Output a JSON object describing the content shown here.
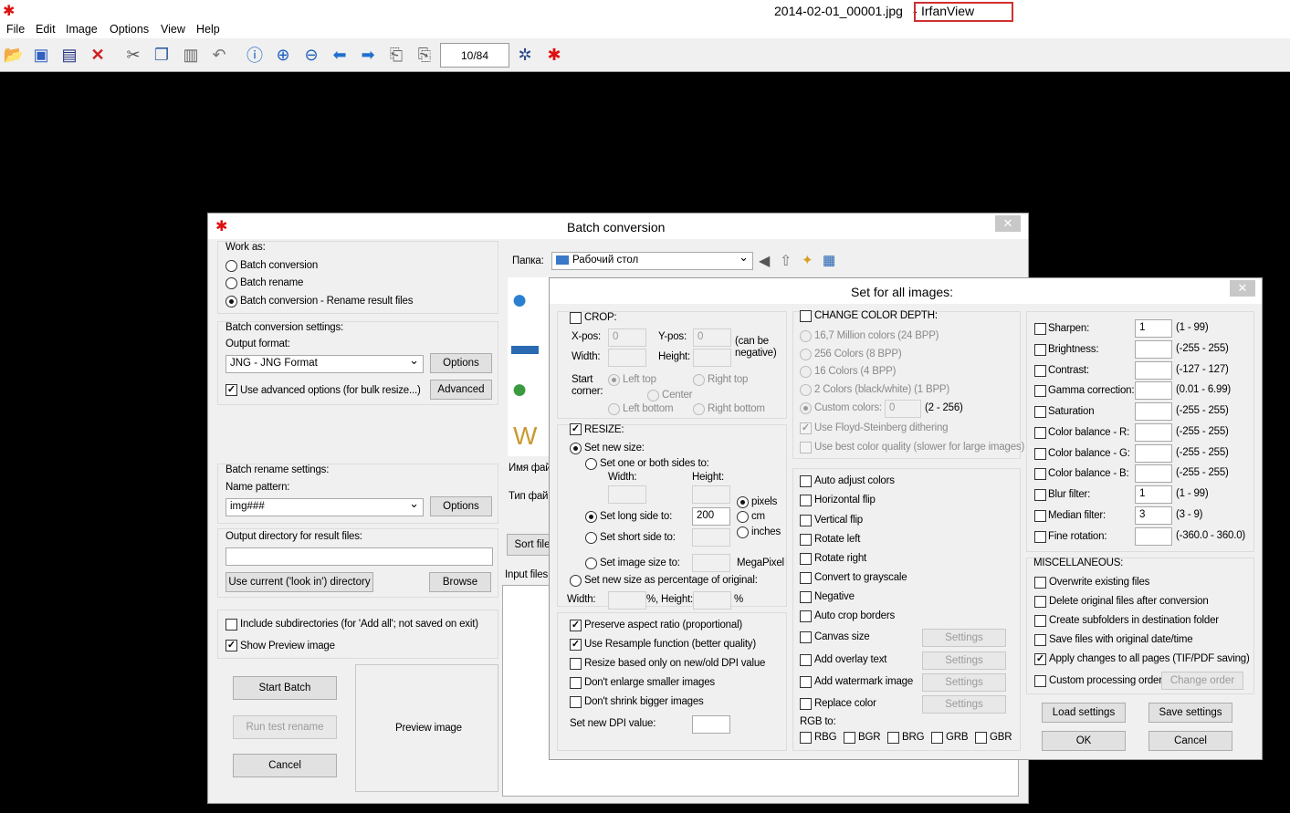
{
  "app": {
    "title_file": "2014-02-01_00001.jpg",
    "title_sep": "-",
    "title_app": "IrfanView"
  },
  "menu": [
    "File",
    "Edit",
    "Image",
    "Options",
    "View",
    "Help"
  ],
  "toolbar": {
    "page_counter": "10/84"
  },
  "batch": {
    "title": "Batch conversion",
    "work_as_label": "Work as:",
    "work_as": [
      "Batch conversion",
      "Batch rename",
      "Batch conversion - Rename result files"
    ],
    "conv_settings_label": "Batch conversion settings:",
    "output_format_label": "Output format:",
    "output_format_value": "JNG - JNG Format",
    "options_btn": "Options",
    "advanced_cb": "Use advanced options (for bulk resize...)",
    "advanced_btn": "Advanced",
    "rename_settings_label": "Batch rename settings:",
    "name_pattern_label": "Name pattern:",
    "name_pattern_value": "img###",
    "outdir_label": "Output directory for result files:",
    "use_current_btn": "Use current ('look in') directory",
    "browse_btn": "Browse",
    "include_sub": "Include subdirectories (for 'Add all'; not saved on exit)",
    "show_preview": "Show Preview image",
    "start_btn": "Start Batch",
    "run_test_btn": "Run test rename",
    "cancel_btn": "Cancel",
    "preview_label": "Preview image",
    "folder_label": "Папка:",
    "folder_value": "Рабочий стол",
    "file_name_label": "Имя фай",
    "file_type_label": "Тип фай",
    "sort_btn": "Sort file",
    "input_files_label": "Input files:"
  },
  "setall": {
    "title": "Set for all images:",
    "crop": {
      "label": "CROP:",
      "xpos": "X-pos:",
      "xval": "0",
      "ypos": "Y-pos:",
      "yval": "0",
      "can_neg": "(can be",
      "can_neg2": "negative)",
      "width": "Width:",
      "height": "Height:",
      "start": "Start",
      "corner": "corner:",
      "lt": "Left top",
      "rt": "Right top",
      "center": "Center",
      "lb": "Left bottom",
      "rb": "Right bottom"
    },
    "resize": {
      "label": "RESIZE:",
      "set_new": "Set new size:",
      "one_or_both": "Set one or both sides to:",
      "width": "Width:",
      "height": "Height:",
      "pixels": "pixels",
      "cm": "cm",
      "inches": "inches",
      "long_side": "Set long side to:",
      "long_val": "200",
      "short_side": "Set short side to:",
      "image_size": "Set image size to:",
      "megapixel": "MegaPixel",
      "percent": "Set new size as percentage of original:",
      "pw": "Width:",
      "pct": "%, Height:",
      "pct2": "%"
    },
    "opts": [
      "Preserve aspect ratio (proportional)",
      "Use Resample function (better quality)",
      "Resize based only on new/old DPI value",
      "Don't enlarge smaller images",
      "Don't shrink bigger images"
    ],
    "dpi_label": "Set new DPI value:",
    "color": {
      "label": "CHANGE COLOR DEPTH:",
      "items": [
        "16,7 Million colors (24 BPP)",
        "256 Colors (8 BPP)",
        "16 Colors (4 BPP)",
        "2 Colors (black/white) (1 BPP)",
        "Custom colors:"
      ],
      "custom_val": "0",
      "custom_range": "(2 - 256)",
      "floyd": "Use Floyd-Steinberg dithering",
      "best": "Use best color quality (slower for large images)"
    },
    "mid": [
      "Auto adjust colors",
      "Horizontal flip",
      "Vertical flip",
      "Rotate left",
      "Rotate right",
      "Convert to grayscale",
      "Negative",
      "Auto crop borders"
    ],
    "mid_settings": [
      "Canvas size",
      "Add overlay text",
      "Add watermark image",
      "Replace color"
    ],
    "settings_btn": "Settings",
    "rgb_label": "RGB to:",
    "rgb": [
      "RBG",
      "BGR",
      "BRG",
      "GRB",
      "GBR"
    ],
    "right": [
      {
        "label": "Sharpen:",
        "val": "1",
        "range": "(1  -  99)"
      },
      {
        "label": "Brightness:",
        "val": "",
        "range": "(-255  -  255)"
      },
      {
        "label": "Contrast:",
        "val": "",
        "range": "(-127  -  127)"
      },
      {
        "label": "Gamma correction:",
        "val": "",
        "range": "(0.01  -  6.99)"
      },
      {
        "label": "Saturation",
        "val": "",
        "range": "(-255  -  255)"
      },
      {
        "label": "Color balance - R:",
        "val": "",
        "range": "(-255  -  255)"
      },
      {
        "label": "Color balance - G:",
        "val": "",
        "range": "(-255  -  255)"
      },
      {
        "label": "Color balance - B:",
        "val": "",
        "range": "(-255  -  255)"
      },
      {
        "label": "Blur filter:",
        "val": "1",
        "range": "(1  -  99)"
      },
      {
        "label": "Median filter:",
        "val": "3",
        "range": "(3  -  9)"
      },
      {
        "label": "Fine rotation:",
        "val": "",
        "range": "(-360.0  -  360.0)"
      }
    ],
    "misc_label": "MISCELLANEOUS:",
    "misc": [
      "Overwrite existing files",
      "Delete original files after conversion",
      "Create subfolders in destination folder",
      "Save files with original date/time",
      "Apply changes to all pages (TIF/PDF saving)",
      "Custom processing order"
    ],
    "change_order": "Change order",
    "load": "Load settings",
    "save": "Save settings",
    "ok": "OK",
    "cancel": "Cancel"
  }
}
